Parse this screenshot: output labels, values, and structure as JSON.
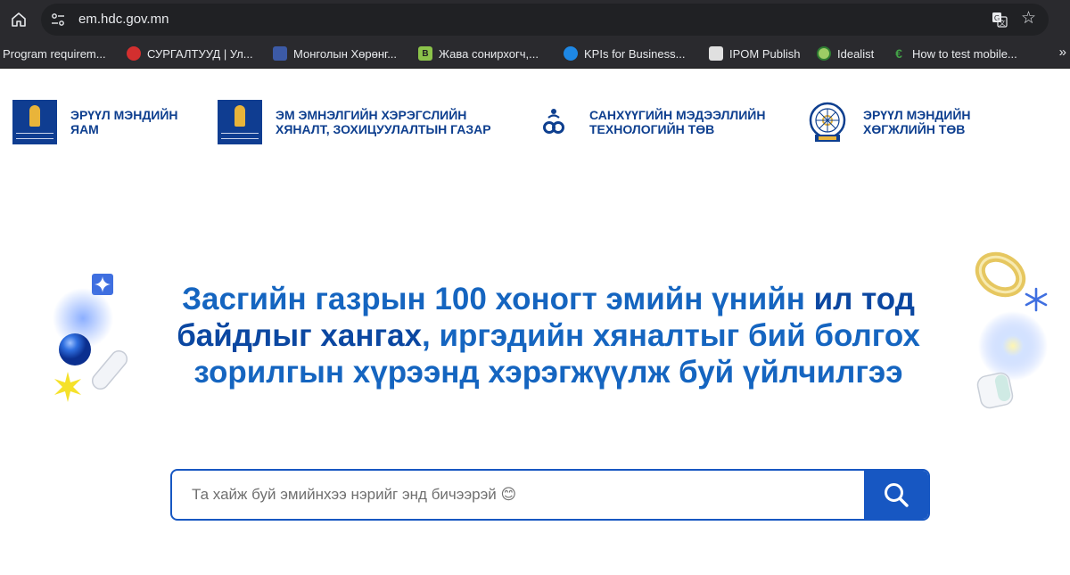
{
  "browser": {
    "url": "em.hdc.gov.mn",
    "bookmarks": [
      {
        "label": "Program requirem...",
        "icon": "none"
      },
      {
        "label": "СУРГАЛТУУД | Ул...",
        "icon": "red-circle-icon"
      },
      {
        "label": "Монголын Хөрөнг...",
        "icon": "blue-building-icon"
      },
      {
        "label": "Жава сонирхогч,...",
        "icon": "green-b-icon"
      },
      {
        "label": "KPIs for Business...",
        "icon": "blue-bird-icon"
      },
      {
        "label": "IPOM Publish",
        "icon": "document-icon"
      },
      {
        "label": "Idealist",
        "icon": "yellow-green-circle-icon"
      },
      {
        "label": "How to test mobile...",
        "icon": "euro-icon"
      }
    ],
    "more_label": "»"
  },
  "header": {
    "orgs": [
      {
        "label": "ЭРҮҮЛ МЭНДИЙН\nЯАМ"
      },
      {
        "label": "ЭМ ЭМНЭЛГИЙН ХЭРЭГСЛИЙН\nХЯНАЛТ, ЗОХИЦУУЛАЛТЫН ГАЗАР"
      },
      {
        "label": "САНХҮҮГИЙН МЭДЭЭЛЛИЙН\nТЕХНОЛОГИЙН ТӨВ"
      },
      {
        "label": "ЭРҮҮЛ МЭНДИЙН\nХӨГЖЛИЙН ТӨВ"
      }
    ]
  },
  "hero": {
    "part1": "Засгийн газрын 100 хоногт эмийн үнийн ",
    "bold1": "ил тод",
    "bold2": "байдлыг хангах",
    "part2": ", иргэдийн хяналтыг бий болгох",
    "line3": "зорилгын хүрээнд хэрэгжүүлж буй үйлчилгээ"
  },
  "search": {
    "placeholder": "Та хайж буй эмийнхээ нэрийг энд бичээрэй 😊",
    "value": ""
  },
  "colors": {
    "brand_blue": "#1565c0",
    "button_blue": "#1757c2",
    "emblem_blue": "#0f3d91"
  }
}
